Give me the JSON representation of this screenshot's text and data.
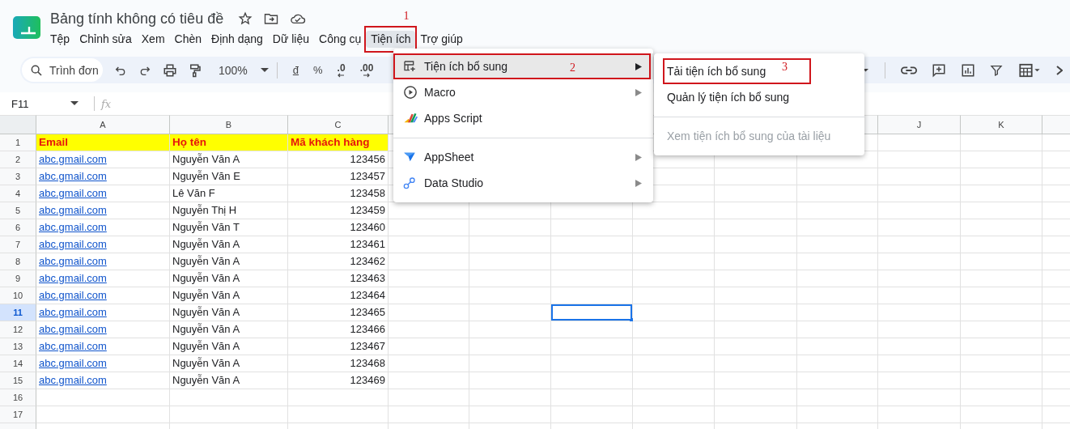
{
  "document": {
    "title": "Bảng tính không có tiêu đề"
  },
  "menu_bar": [
    {
      "label": "Tệp",
      "selected": false
    },
    {
      "label": "Chỉnh sửa",
      "selected": false
    },
    {
      "label": "Xem",
      "selected": false
    },
    {
      "label": "Chèn",
      "selected": false
    },
    {
      "label": "Định dạng",
      "selected": false
    },
    {
      "label": "Dữ liệu",
      "selected": false
    },
    {
      "label": "Công cụ",
      "selected": false
    },
    {
      "label": "Tiện ích",
      "selected": true,
      "annotation": "1"
    },
    {
      "label": "Trợ giúp",
      "selected": false
    }
  ],
  "toolbar": {
    "search": {
      "placeholder": "Trình đơn"
    },
    "zoom": "100%",
    "number_formats": [
      {
        "label": "đ",
        "kind": "currency"
      },
      {
        "label": "%",
        "kind": "percent"
      },
      {
        "label": ".0",
        "kind": "decrease"
      },
      {
        "label": ".00",
        "kind": "increase"
      }
    ]
  },
  "formula_bar": {
    "cell_name": "F11",
    "fx": "fx"
  },
  "column_headers": {
    "left": [
      "A",
      "B",
      "C"
    ],
    "right": [
      "J",
      "K"
    ]
  },
  "rows": [
    {
      "number": "1",
      "kind": "header",
      "selected": false,
      "cells": [
        "Email",
        "Họ tên",
        "Mã khách hàng"
      ]
    },
    {
      "number": "2",
      "kind": "data",
      "selected": false,
      "cells": [
        "abc.gmail.com",
        "Nguyễn Văn A",
        "123456"
      ]
    },
    {
      "number": "3",
      "kind": "data",
      "selected": false,
      "cells": [
        "abc.gmail.com",
        "Nguyễn Văn E",
        "123457"
      ]
    },
    {
      "number": "4",
      "kind": "data",
      "selected": false,
      "cells": [
        "abc.gmail.com",
        "Lê Văn F",
        "123458"
      ]
    },
    {
      "number": "5",
      "kind": "data",
      "selected": false,
      "cells": [
        "abc.gmail.com",
        "Nguyễn Thị H",
        "123459"
      ]
    },
    {
      "number": "6",
      "kind": "data",
      "selected": false,
      "cells": [
        "abc.gmail.com",
        "Nguyễn Văn T",
        "123460"
      ]
    },
    {
      "number": "7",
      "kind": "data",
      "selected": false,
      "cells": [
        "abc.gmail.com",
        "Nguyễn Văn A",
        "123461"
      ]
    },
    {
      "number": "8",
      "kind": "data",
      "selected": false,
      "cells": [
        "abc.gmail.com",
        "Nguyễn Văn A",
        "123462"
      ]
    },
    {
      "number": "9",
      "kind": "data",
      "selected": false,
      "cells": [
        "abc.gmail.com",
        "Nguyễn Văn A",
        "123463"
      ]
    },
    {
      "number": "10",
      "kind": "data",
      "selected": false,
      "cells": [
        "abc.gmail.com",
        "Nguyễn Văn A",
        "123464"
      ]
    },
    {
      "number": "11",
      "kind": "data",
      "selected": true,
      "cells": [
        "abc.gmail.com",
        "Nguyễn Văn A",
        "123465"
      ]
    },
    {
      "number": "12",
      "kind": "data",
      "selected": false,
      "cells": [
        "abc.gmail.com",
        "Nguyễn Văn A",
        "123466"
      ]
    },
    {
      "number": "13",
      "kind": "data",
      "selected": false,
      "cells": [
        "abc.gmail.com",
        "Nguyễn Văn A",
        "123467"
      ]
    },
    {
      "number": "14",
      "kind": "data",
      "selected": false,
      "cells": [
        "abc.gmail.com",
        "Nguyễn Văn A",
        "123468"
      ]
    },
    {
      "number": "15",
      "kind": "data",
      "selected": false,
      "cells": [
        "abc.gmail.com",
        "Nguyễn Văn A",
        "123469"
      ]
    },
    {
      "number": "16",
      "kind": "empty",
      "selected": false,
      "cells": []
    },
    {
      "number": "17",
      "kind": "empty",
      "selected": false,
      "cells": []
    }
  ],
  "extensions_menu": {
    "items": [
      {
        "kind": "item",
        "label": "Tiện ích bổ sung",
        "submenu": true,
        "selected": true,
        "annotation": "2"
      },
      {
        "kind": "item",
        "label": "Macro",
        "submenu": true,
        "selected": false
      },
      {
        "kind": "item",
        "label": "Apps Script",
        "submenu": false,
        "selected": false
      },
      {
        "kind": "divider"
      },
      {
        "kind": "item",
        "label": "AppSheet",
        "submenu": true,
        "selected": false
      },
      {
        "kind": "item",
        "label": "Data Studio",
        "submenu": true,
        "selected": false
      }
    ]
  },
  "addons_submenu": {
    "items": [
      {
        "kind": "item",
        "label": "Tải tiện ích bổ sung",
        "disabled": false,
        "annotation": "3"
      },
      {
        "kind": "item",
        "label": "Quản lý tiện ích bổ sung",
        "disabled": false
      },
      {
        "kind": "divider"
      },
      {
        "kind": "item",
        "label": "Xem tiện ích bổ sung của tài liệu",
        "disabled": true
      }
    ]
  }
}
